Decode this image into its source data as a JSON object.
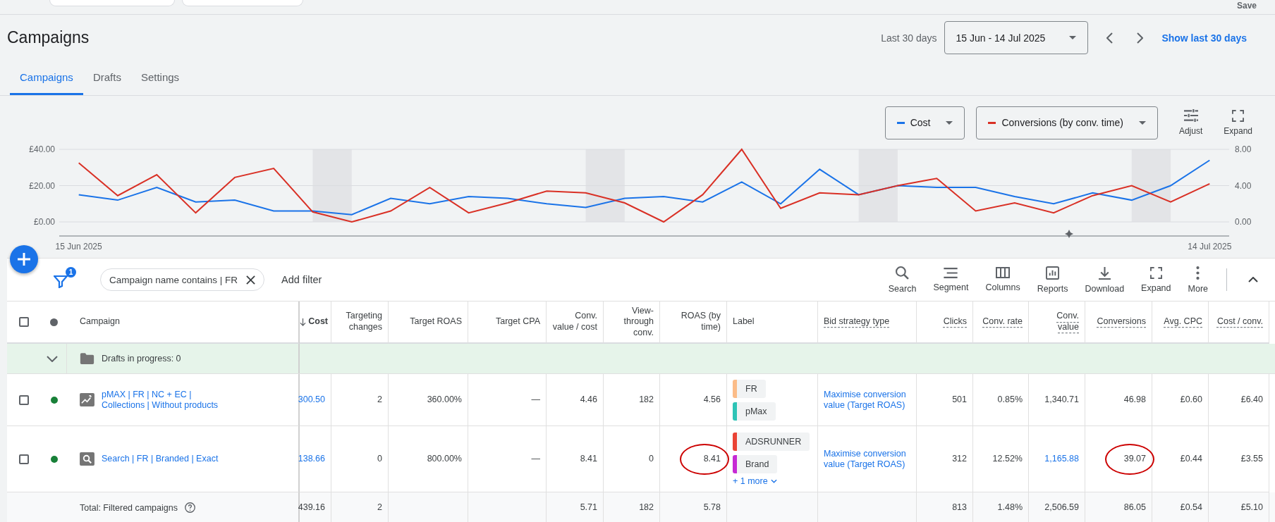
{
  "top_bar": {
    "save_label": "Save"
  },
  "header": {
    "title": "Campaigns",
    "range_label": "Last 30 days",
    "date_select": "15 Jun - 14 Jul 2025",
    "show_link": "Show last 30 days"
  },
  "tabs": [
    {
      "label": "Campaigns",
      "selected": true
    },
    {
      "label": "Drafts",
      "selected": false
    },
    {
      "label": "Settings",
      "selected": false
    }
  ],
  "chart": {
    "actions": [
      {
        "label": "Adjust",
        "kind": "adjust"
      },
      {
        "label": "Expand",
        "kind": "expand"
      }
    ],
    "chart_data": {
      "type": "line",
      "categories": [
        "15 Jun 2025",
        null,
        null,
        null,
        null,
        null,
        null,
        null,
        null,
        null,
        null,
        null,
        null,
        null,
        null,
        null,
        null,
        null,
        null,
        null,
        null,
        null,
        null,
        null,
        null,
        null,
        null,
        null,
        null,
        "14 Jul 2025"
      ],
      "ylim": [
        0,
        40
      ],
      "y2lim": [
        0,
        8
      ],
      "yticks": [
        {
          "value": 0,
          "label": "£0.00"
        },
        {
          "value": 20,
          "label": "£20.00"
        },
        {
          "value": 40,
          "label": "£40.00"
        }
      ],
      "y2ticks": [
        {
          "value": 0,
          "label": "0.00"
        },
        {
          "value": 4,
          "label": "4.00"
        },
        {
          "value": 8,
          "label": "8.00"
        }
      ],
      "series": [
        {
          "name": "Cost",
          "color": "#1a73e8",
          "values": [
            15,
            12,
            19,
            11,
            12,
            6,
            6,
            4,
            13,
            10,
            14,
            13,
            10,
            8,
            13,
            14,
            11,
            22,
            10,
            29,
            15,
            20,
            19,
            19,
            14,
            10,
            16,
            12,
            20,
            34
          ]
        },
        {
          "name": "Conversions (by conv. time)",
          "color": "#d93025",
          "axis": "y2",
          "values": [
            6.5,
            2.9,
            5.2,
            1,
            4.9,
            5.9,
            1.1,
            0,
            1.2,
            3.8,
            1,
            2.1,
            3.4,
            3.2,
            2.1,
            0,
            3,
            8,
            1.5,
            3.2,
            3,
            4,
            4.8,
            1.2,
            2.1,
            1,
            2.9,
            4,
            2.2,
            4.2
          ]
        }
      ]
    }
  },
  "filter_bar": {
    "filter_count": "1",
    "chip": "Campaign name contains | FR",
    "add_filter": "Add filter"
  },
  "toolbar": [
    {
      "label": "Search",
      "kind": "search"
    },
    {
      "label": "Segment",
      "kind": "segment"
    },
    {
      "label": "Columns",
      "kind": "columns"
    },
    {
      "label": "Reports",
      "kind": "reports"
    },
    {
      "label": "Download",
      "kind": "download"
    },
    {
      "label": "Expand",
      "kind": "expand"
    },
    {
      "label": "More",
      "kind": "more"
    }
  ],
  "table": {
    "columns": [
      {
        "kind": "checkbox",
        "checked": false
      },
      {
        "kind": "status"
      },
      {
        "kind": "campaign",
        "label": "Campaign"
      },
      {
        "kind": "number",
        "label": "Cost",
        "sorted": true,
        "underlined": false
      },
      {
        "kind": "number",
        "label": "Targeting changes",
        "sorted": false,
        "underlined": false
      },
      {
        "kind": "number",
        "label": "Target ROAS",
        "sorted": false,
        "underlined": false
      },
      {
        "kind": "number",
        "label": "Target CPA",
        "sorted": false,
        "underlined": false
      },
      {
        "kind": "number",
        "label": "Conv. value / cost",
        "sorted": false,
        "underlined": false
      },
      {
        "kind": "number",
        "label": "View-through conv.",
        "sorted": false,
        "underlined": false
      },
      {
        "kind": "number",
        "label": "ROAS (by time)",
        "sorted": false,
        "underlined": false
      },
      {
        "kind": "label",
        "label": "Label",
        "sorted": false,
        "underlined": false
      },
      {
        "kind": "text",
        "label": "Bid strategy type",
        "sorted": false,
        "underlined": true
      },
      {
        "kind": "number",
        "label": "Clicks",
        "sorted": false,
        "underlined": true
      },
      {
        "kind": "number",
        "label": "Conv. rate",
        "sorted": false,
        "underlined": true
      },
      {
        "kind": "number",
        "label": "Conv. value",
        "sorted": false,
        "underlined": true
      },
      {
        "kind": "number",
        "label": "Conversions",
        "sorted": false,
        "underlined": true
      },
      {
        "kind": "number",
        "label": "Avg. CPC",
        "sorted": false,
        "underlined": true
      },
      {
        "kind": "number",
        "label": "Cost / conv.",
        "sorted": false,
        "underlined": true
      }
    ],
    "rows": [
      {
        "kind": "drafts",
        "expanded": false,
        "text": "Drafts in progress: 0"
      },
      {
        "kind": "campaign",
        "checked": false,
        "color": "#188038",
        "campaign": {
          "kind": "pmax",
          "name": "pMAX | FR | NC + EC | Collections | Without products"
        },
        "cells": [
          {
            "text": "300.50",
            "link": true
          },
          {
            "text": "2",
            "link": false
          },
          {
            "text": "360.00%",
            "link": false
          },
          {
            "text": "—",
            "link": false
          },
          {
            "text": "4.46",
            "link": false
          },
          {
            "text": "182",
            "link": false
          },
          {
            "text": "4.56",
            "link": false,
            "circled": false
          },
          {
            "labels": [
              {
                "text": "FR",
                "color": "#fbbc88"
              },
              {
                "text": "pMax",
                "color": "#2ec4b6"
              }
            ]
          },
          {
            "text": "Maximise conversion value (Target ROAS)",
            "link": true
          },
          {
            "text": "501",
            "link": false
          },
          {
            "text": "0.85%",
            "link": false
          },
          {
            "text": "1,340.71",
            "link": false
          },
          {
            "text": "46.98",
            "link": false,
            "circled": false
          },
          {
            "text": "£0.60",
            "link": false
          },
          {
            "text": "£6.40",
            "link": false
          }
        ]
      },
      {
        "kind": "campaign",
        "checked": false,
        "color": "#188038",
        "campaign": {
          "kind": "search",
          "name": "Search | FR | Branded | Exact"
        },
        "cells": [
          {
            "text": "138.66",
            "link": true
          },
          {
            "text": "0",
            "link": false
          },
          {
            "text": "800.00%",
            "link": false
          },
          {
            "text": "—",
            "link": false
          },
          {
            "text": "8.41",
            "link": false
          },
          {
            "text": "0",
            "link": false
          },
          {
            "text": "8.41",
            "link": false,
            "circled": true
          },
          {
            "labels": [
              {
                "text": "ADSRUNNER",
                "color": "#ea4335"
              },
              {
                "text": "Brand",
                "color": "#c62ad4"
              }
            ],
            "more": "+ 1 more"
          },
          {
            "text": "Maximise conversion value (Target ROAS)",
            "link": true
          },
          {
            "text": "312",
            "link": false
          },
          {
            "text": "12.52%",
            "link": false
          },
          {
            "text": "1,165.88",
            "link": true
          },
          {
            "text": "39.07",
            "link": false,
            "circled": true
          },
          {
            "text": "£0.44",
            "link": false
          },
          {
            "text": "£3.55",
            "link": false
          }
        ]
      },
      {
        "kind": "total",
        "text": "Total: Filtered campaigns",
        "cells": [
          {
            "text": "439.16"
          },
          {
            "text": "2"
          },
          null,
          null,
          {
            "text": "5.71"
          },
          {
            "text": "182"
          },
          {
            "text": "5.78"
          },
          null,
          null,
          {
            "text": "813"
          },
          {
            "text": "1.48%"
          },
          {
            "text": "2,506.59"
          },
          {
            "text": "86.05"
          },
          {
            "text": "£0.54"
          },
          {
            "text": "£5.10"
          }
        ]
      }
    ]
  }
}
